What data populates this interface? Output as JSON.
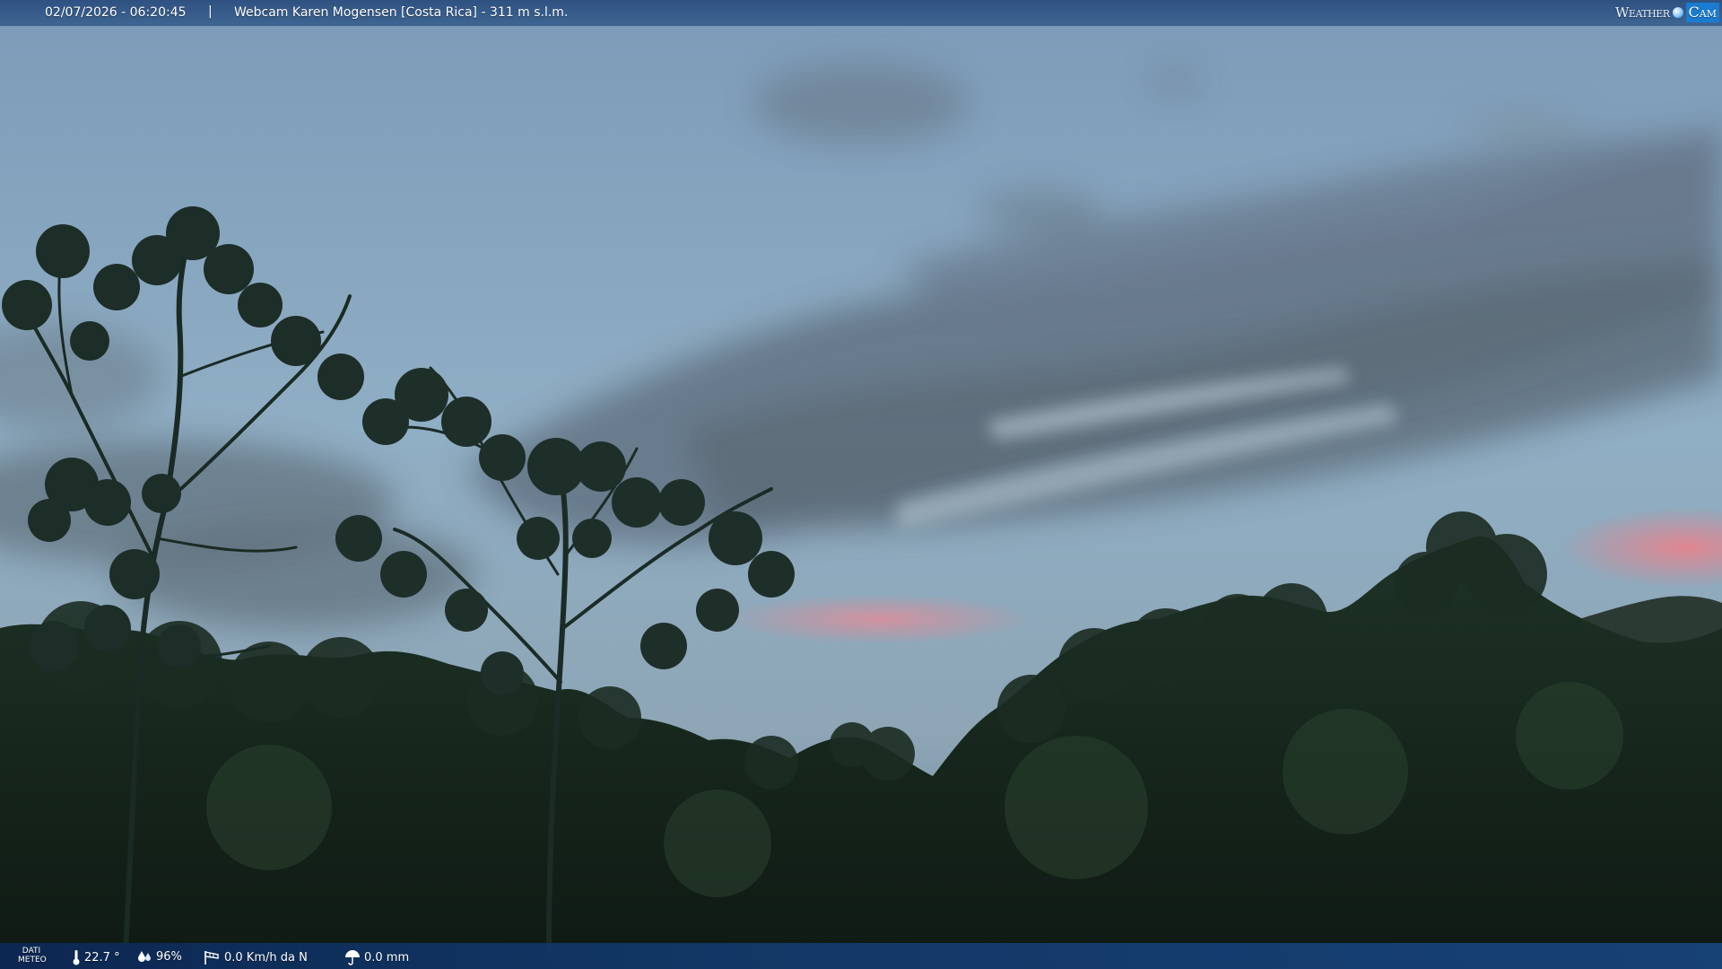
{
  "overlay_top": {
    "datetime": "02/07/2026 - 06:20:45",
    "separator": "|",
    "location": "Webcam Karen Mogensen [Costa Rica]  - 311 m s.l.m.",
    "logo": {
      "weather_text": "Weather",
      "cam_text": "Cam"
    }
  },
  "overlay_bottom": {
    "label_line1": "DATI",
    "label_line2": "METEO",
    "temperature": "22.7 °",
    "humidity": "96%",
    "wind": "0.0 Km/h da N",
    "rain": "0.0 mm",
    "icons": {
      "temperature": "thermometer-icon",
      "humidity": "droplets-icon",
      "wind": "wind-sock-icon",
      "rain": "umbrella-icon"
    }
  },
  "colors": {
    "sky_top": "#7e9eba",
    "sky_horizon": "#9ab4c6",
    "cloud_dark": "#5f6f7e",
    "pink_glow": "#e58a93",
    "forest_dark": "#16241c",
    "bar_blue": "#1a4a86",
    "logo_blue": "#1a7bd0"
  }
}
